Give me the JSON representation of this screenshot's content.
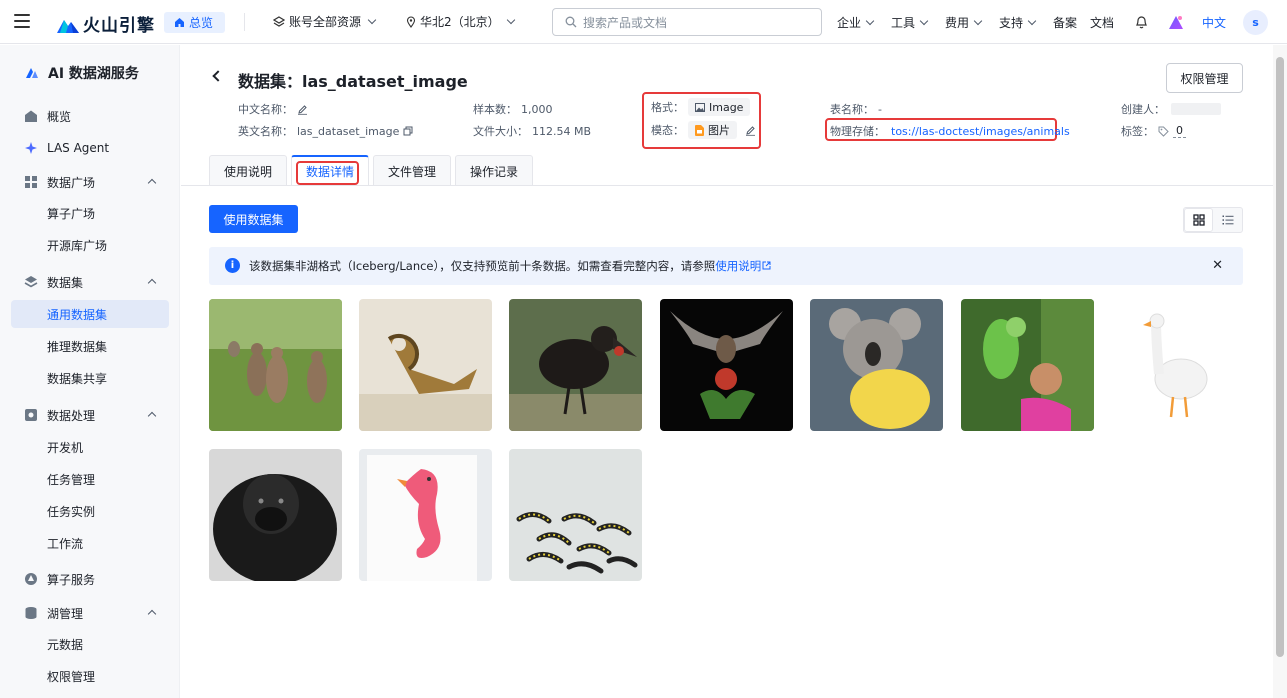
{
  "topbar": {
    "brand": "火山引擎",
    "home_label": "总览",
    "account_scope": "账号全部资源",
    "region": "华北2（北京）",
    "search_placeholder": "搜索产品或文档",
    "nav": [
      "企业",
      "工具",
      "费用",
      "支持",
      "备案",
      "文档"
    ],
    "language": "中文",
    "avatar_initial": "s"
  },
  "sidebar": {
    "title": "AI 数据湖服务",
    "items": [
      {
        "label": "概览",
        "icon": "home-icon"
      },
      {
        "label": "LAS Agent",
        "icon": "sparkle-icon"
      },
      {
        "label": "数据广场",
        "icon": "grid-icon",
        "expanded": true
      },
      {
        "label": "算子广场"
      },
      {
        "label": "开源库广场"
      },
      {
        "label": "数据集",
        "icon": "layers-icon",
        "expanded": true
      },
      {
        "label": "通用数据集",
        "active": true
      },
      {
        "label": "推理数据集"
      },
      {
        "label": "数据集共享"
      },
      {
        "label": "数据处理",
        "icon": "process-icon",
        "expanded": true
      },
      {
        "label": "开发机"
      },
      {
        "label": "任务管理"
      },
      {
        "label": "任务实例"
      },
      {
        "label": "工作流"
      },
      {
        "label": "算子服务",
        "icon": "operator-icon"
      },
      {
        "label": "湖管理",
        "icon": "database-icon",
        "expanded": true
      },
      {
        "label": "元数据"
      },
      {
        "label": "权限管理"
      }
    ]
  },
  "header": {
    "title": "数据集：las_dataset_image",
    "perm_button": "权限管理",
    "cn_name_label": "中文名称：",
    "en_name_label": "英文名称：",
    "en_name_value": "las_dataset_image",
    "sample_count_label": "样本数：",
    "sample_count_value": "1,000",
    "file_size_label": "文件大小：",
    "file_size_value": "112.54 MB",
    "format_label": "格式：",
    "format_value": "Image",
    "modality_label": "模态：",
    "modality_value": "图片",
    "table_name_label": "表名称：",
    "table_name_value": "-",
    "storage_label": "物理存储：",
    "storage_value": "tos://las-doctest/images/animals",
    "creator_label": "创建人：",
    "tags_label": "标签：",
    "tags_value": "0"
  },
  "tabs": [
    "使用说明",
    "数据详情",
    "文件管理",
    "操作记录"
  ],
  "active_tab": "数据详情",
  "content": {
    "use_button": "使用数据集",
    "notice": "该数据集非湖格式（Iceberg/Lance），仅支持预览前十条数据。如需查看完整内容，请参照",
    "notice_link": "使用说明"
  },
  "images": [
    "kangaroos",
    "curly-tail lizard",
    "ground hornbill",
    "fruit bat",
    "koala",
    "parrot and girl",
    "white goose",
    "gorilla",
    "seahorse painting",
    "caterpillars"
  ]
}
